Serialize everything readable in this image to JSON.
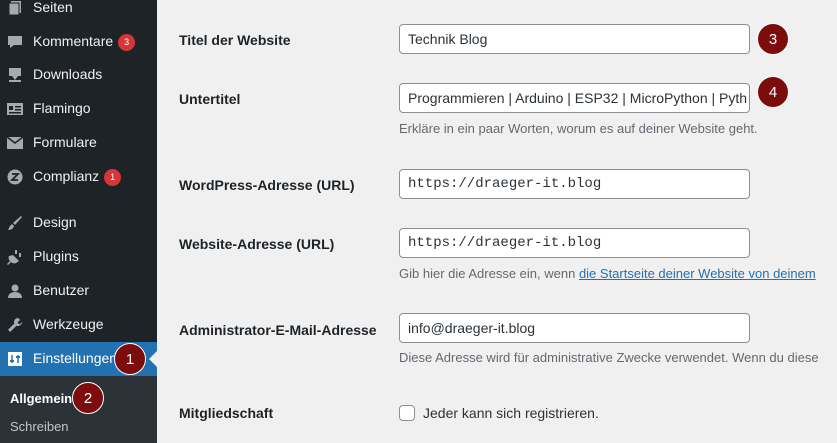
{
  "sidebar": {
    "items": [
      {
        "label": "Seiten",
        "icon": "pages-icon"
      },
      {
        "label": "Kommentare",
        "icon": "comments-icon",
        "badge": "3"
      },
      {
        "label": "Downloads",
        "icon": "download-icon"
      },
      {
        "label": "Flamingo",
        "icon": "flamingo-icon"
      },
      {
        "label": "Formulare",
        "icon": "mail-icon"
      },
      {
        "label": "Complianz",
        "icon": "complianz-icon",
        "badge": "1"
      },
      {
        "label": "Design",
        "icon": "brush-icon"
      },
      {
        "label": "Plugins",
        "icon": "plugin-icon"
      },
      {
        "label": "Benutzer",
        "icon": "user-icon"
      },
      {
        "label": "Werkzeuge",
        "icon": "wrench-icon"
      },
      {
        "label": "Einstellungen",
        "icon": "settings-icon"
      }
    ],
    "submenu": [
      {
        "label": "Allgemein"
      },
      {
        "label": "Schreiben"
      }
    ]
  },
  "steps": [
    "1",
    "2",
    "3",
    "4"
  ],
  "form": {
    "site_title": {
      "label": "Titel der Website",
      "value": "Technik Blog"
    },
    "tagline": {
      "label": "Untertitel",
      "value": "Programmieren | Arduino | ESP32 | MicroPython | Pyth",
      "description": "Erkläre in ein paar Worten, worum es auf deiner Website geht."
    },
    "wp_url": {
      "label": "WordPress-Adresse (URL)",
      "value": "https://draeger-it.blog"
    },
    "site_url": {
      "label": "Website-Adresse (URL)",
      "value": "https://draeger-it.blog",
      "description_prefix": "Gib hier die Adresse ein, wenn ",
      "description_link": "die Startseite deiner Website von deinem"
    },
    "admin_email": {
      "label": "Administrator-E-Mail-Adresse",
      "value": "info@draeger-it.blog",
      "description": "Diese Adresse wird für administrative Zwecke verwendet. Wenn du diese"
    },
    "membership": {
      "label": "Mitgliedschaft",
      "checkbox_label": "Jeder kann sich registrieren.",
      "checked": false
    }
  },
  "colors": {
    "sidebar_bg": "#1d2327",
    "active_bg": "#2271b1",
    "badge": "#d63638",
    "step_marker": "#7d0c0c"
  }
}
